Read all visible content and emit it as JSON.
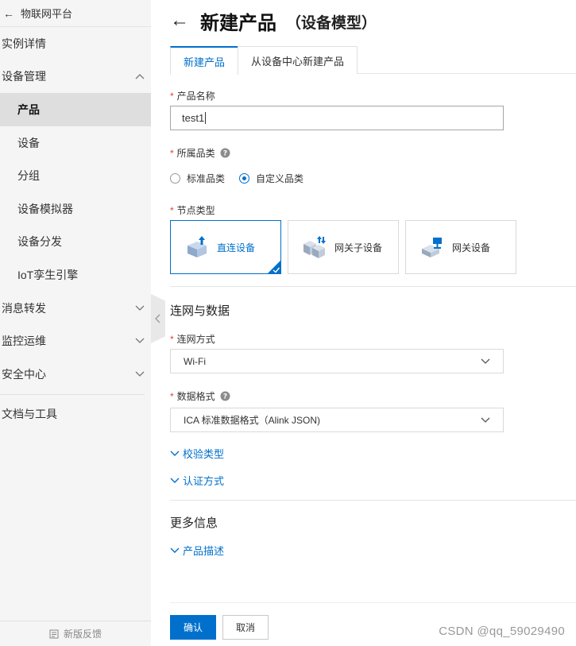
{
  "sidebar": {
    "top_label": "物联网平台",
    "items": [
      {
        "label": "实例详情",
        "sub": false,
        "active": false,
        "chevron": ""
      },
      {
        "label": "设备管理",
        "sub": false,
        "active": false,
        "chevron": "up"
      },
      {
        "label": "产品",
        "sub": true,
        "active": true,
        "chevron": ""
      },
      {
        "label": "设备",
        "sub": true,
        "active": false,
        "chevron": ""
      },
      {
        "label": "分组",
        "sub": true,
        "active": false,
        "chevron": ""
      },
      {
        "label": "设备模拟器",
        "sub": true,
        "active": false,
        "chevron": ""
      },
      {
        "label": "设备分发",
        "sub": true,
        "active": false,
        "chevron": ""
      },
      {
        "label": "IoT孪生引擎",
        "sub": true,
        "active": false,
        "chevron": ""
      },
      {
        "label": "消息转发",
        "sub": false,
        "active": false,
        "chevron": "down"
      },
      {
        "label": "监控运维",
        "sub": false,
        "active": false,
        "chevron": "down"
      },
      {
        "label": "安全中心",
        "sub": false,
        "active": false,
        "chevron": "down"
      }
    ],
    "docs_label": "文档与工具",
    "feedback_label": "新版反馈"
  },
  "header": {
    "title": "新建产品",
    "subtitle": "（设备模型）"
  },
  "tabs": [
    {
      "label": "新建产品",
      "active": true
    },
    {
      "label": "从设备中心新建产品",
      "active": false
    }
  ],
  "form": {
    "product_name": {
      "label": "产品名称",
      "value": "test1"
    },
    "category": {
      "label": "所属品类",
      "options": [
        {
          "label": "标准品类",
          "checked": false
        },
        {
          "label": "自定义品类",
          "checked": true
        }
      ]
    },
    "node_type": {
      "label": "节点类型",
      "options": [
        {
          "label": "直连设备",
          "selected": true
        },
        {
          "label": "网关子设备",
          "selected": false
        },
        {
          "label": "网关设备",
          "selected": false
        }
      ]
    },
    "network_section_title": "连网与数据",
    "network_method": {
      "label": "连网方式",
      "value": "Wi-Fi"
    },
    "data_format": {
      "label": "数据格式",
      "value": "ICA 标准数据格式（Alink JSON)"
    },
    "verify_type_label": "校验类型",
    "auth_method_label": "认证方式",
    "more_section_title": "更多信息",
    "product_desc_label": "产品描述"
  },
  "buttons": {
    "confirm": "确认",
    "cancel": "取消"
  },
  "watermark": "CSDN @qq_59029490",
  "colors": {
    "primary": "#0070cc",
    "required": "#e53e3e"
  }
}
